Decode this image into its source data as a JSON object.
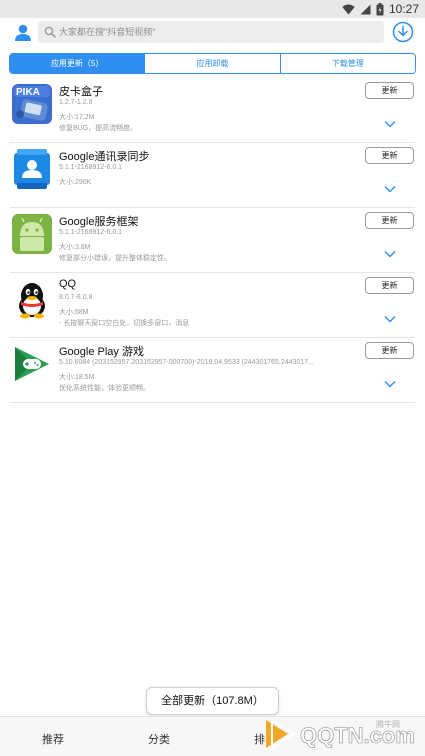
{
  "status_bar": {
    "time": "10:27"
  },
  "header": {
    "search_placeholder": "大家都在搜\"抖音短视频\"",
    "icons": [
      "user-icon",
      "search-icon",
      "download-icon"
    ]
  },
  "tabs": [
    {
      "label": "应用更新（5）",
      "active": true
    },
    {
      "label": "应用卸载",
      "active": false
    },
    {
      "label": "下载管理",
      "active": false
    }
  ],
  "apps": [
    {
      "name": "皮卡盒子",
      "version": "1.2.7-1.2.8",
      "size": "大小:17.2M",
      "desc": "修复BUG，提高流畅度。",
      "button": "更新",
      "icon": "pika-box-icon"
    },
    {
      "name": "Google通讯录同步",
      "version": "5.1.1-2168912-6.0.1",
      "size": "大小:290K",
      "desc": "",
      "button": "更新",
      "icon": "google-contacts-icon"
    },
    {
      "name": "Google服务框架",
      "version": "5.1.1-2168912-6.0.1",
      "size": "大小:3.8M",
      "desc": "修复部分小错误，提升整体稳定性。",
      "button": "更新",
      "icon": "android-icon"
    },
    {
      "name": "QQ",
      "version": "8.0.7-8.0.8",
      "size": "大小:68M",
      "desc": "- 长按聊天窗口空白处，切换多窗口，消息",
      "button": "更新",
      "icon": "qq-penguin-icon"
    },
    {
      "name": "Google Play 游戏",
      "version": "5.10.6084 (203152957.203152957-000700)-2019.04.9533 (244301765.2443017...",
      "size": "大小:18.5M",
      "desc": "优化系统性能，体验更顺畅。",
      "button": "更新",
      "icon": "google-play-games-icon"
    }
  ],
  "update_all": "全部更新（107.8M）",
  "bottom_nav": [
    "推荐",
    "分类",
    "排"
  ],
  "watermark": {
    "site": "腾牛网",
    "logo_text": "QQTN.com"
  },
  "colors": {
    "accent": "#2f8ef0",
    "divider": "#e6e6e6",
    "subtext": "#9a9a9a"
  }
}
